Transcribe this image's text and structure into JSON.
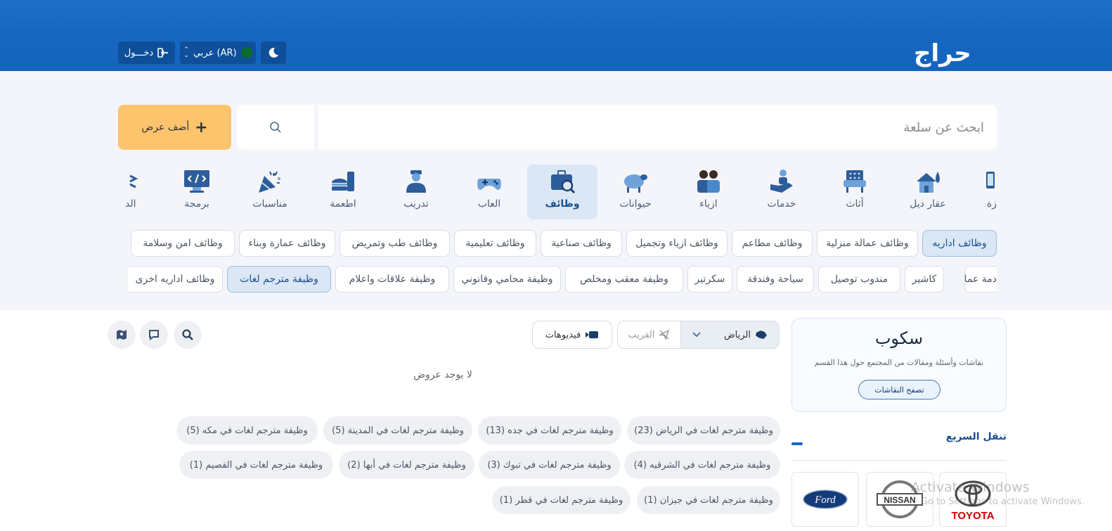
{
  "header": {
    "logo": "حراج",
    "login_label": "دخـــول",
    "language_label": "عربي (AR)",
    "moon_icon": "moon-icon"
  },
  "search": {
    "placeholder": "ابحث عن سلعة",
    "add_offer_label": "أضف عرض"
  },
  "categories": [
    {
      "label": "زة",
      "icon": "device-icon"
    },
    {
      "label": "عقار ديل",
      "icon": "house-icon"
    },
    {
      "label": "أثاث",
      "icon": "furniture-icon"
    },
    {
      "label": "خدمات",
      "icon": "service-hand-icon"
    },
    {
      "label": "ازياء",
      "icon": "people-icon"
    },
    {
      "label": "حيوانات",
      "icon": "sheep-icon"
    },
    {
      "label": "وظائف",
      "icon": "briefcase-icon"
    },
    {
      "label": "العاب",
      "icon": "gamepad-icon"
    },
    {
      "label": "تدريب",
      "icon": "trainer-icon"
    },
    {
      "label": "اطعمة",
      "icon": "food-icon"
    },
    {
      "label": "مناسبات",
      "icon": "party-icon"
    },
    {
      "label": "برمجة",
      "icon": "code-monitor-icon"
    },
    {
      "label": "الد",
      "icon": "partial-icon"
    }
  ],
  "subcategories_row1": [
    "وظائف اداريه",
    "وظائف عمالة منزلية",
    "وظائف مطاعم",
    "وظائف ازياء وتجميل",
    "وظائف صناعية",
    "وظائف تعليمية",
    "وظائف طب وتمريض",
    "وظائف عمارة وبناء",
    "وظائف امن وسلامة"
  ],
  "subcategories_row2": [
    "دمة عملاء",
    "كاشير",
    "مندوب توصيل",
    "سياحة وفندقة",
    "سكرتير",
    "وظيفة معقب ومخلص",
    "وظيفة محامي وقانوني",
    "وظيفة علاقات واعلام",
    "وظيفة مترجم لغات",
    "وظائف اداريه اخرى"
  ],
  "filters": {
    "city": "الرياض",
    "nearby": "القريب",
    "videos": "فيديوهات"
  },
  "empty_message": "لا يوجد عروض",
  "location_tags": [
    "وظيفة مترجم لغات في الرياض (23)",
    "وظيفة مترجم لغات في جده (13)",
    "وظيفة مترجم لغات في المدينة (5)",
    "وظيفة مترجم لغات في مكه (5)",
    "وظيفة مترجم لغات في الشرقيه (4)",
    "وظيفة مترجم لغات في تبوك (3)",
    "وظيفة مترجم لغات في أبها (2)",
    "وظيفة مترجم لغات في القصيم (1)",
    "وظيفة مترجم لغات في جيزان (1)",
    "وظيفة مترجم لغات في قطر (1)"
  ],
  "sqoop": {
    "logo": "سكوب",
    "description": "نقاشات وأسئلة ومقالات من المجتمع حول هذا القسم",
    "button": "تصفح النقاشات"
  },
  "quick_nav": {
    "title": "تنقل السريع",
    "brands": [
      "TOYOTA",
      "NISSAN",
      "Ford"
    ]
  },
  "watermark": {
    "line1": "Activate Windows",
    "line2": "Go to Settings to activate Windows."
  }
}
